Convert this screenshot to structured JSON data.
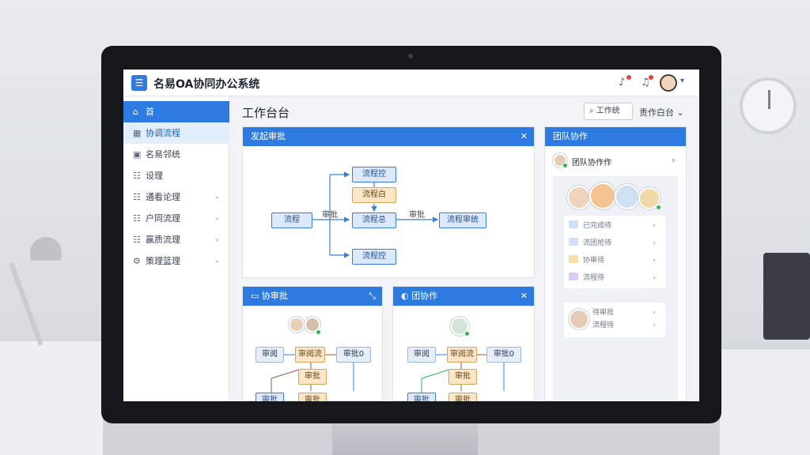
{
  "header": {
    "logo_glyph": "☰",
    "app_title": "名易OA协同办公系统",
    "icons": [
      "bell-icon",
      "notification-icon",
      "avatar"
    ]
  },
  "sidebar": {
    "items": [
      {
        "icon": "home-icon",
        "glyph": "⌂",
        "label": "首"
      },
      {
        "icon": "grid-icon",
        "glyph": "▦",
        "label": "协调流程"
      },
      {
        "icon": "box-icon",
        "glyph": "▣",
        "label": "名易邻统"
      },
      {
        "icon": "list-icon",
        "glyph": "☷",
        "label": "设理"
      },
      {
        "icon": "list-icon",
        "glyph": "☷",
        "label": "通看论理"
      },
      {
        "icon": "list-icon",
        "glyph": "☷",
        "label": "户同流理"
      },
      {
        "icon": "list-icon",
        "glyph": "☷",
        "label": "赢质流理"
      },
      {
        "icon": "gear-icon",
        "glyph": "⚙",
        "label": "策理篮理"
      }
    ]
  },
  "main": {
    "page_title": "工作台台",
    "search_label": "工作统",
    "workspace_label": "责作白台"
  },
  "panel_flow": {
    "title": "发起审批",
    "nodes": {
      "start": "流程",
      "top": "流程控",
      "mid_orange": "流程白",
      "center": "流程总",
      "bottom": "流程控",
      "end": "流程审统"
    },
    "edge_left": "审批",
    "edge_right": "审批"
  },
  "panel_small1": {
    "title": "协审批",
    "nodes": [
      "审阅",
      "审阅流",
      "审批0",
      "审批",
      "审批",
      "审批"
    ]
  },
  "panel_small2": {
    "title": "团协作",
    "nodes": [
      "审阅",
      "审阅流",
      "审批0",
      "审批",
      "审批",
      "审批"
    ]
  },
  "panel_team": {
    "title": "团队协作",
    "sub_label": "团队协作作",
    "rows": [
      "已完成待",
      "流团抢待",
      "协审待",
      "流程待"
    ],
    "bottom_rows": [
      "待审批",
      "流程待"
    ]
  },
  "colors": {
    "primary": "#2d7be0",
    "node_blue": "#dbe9fb",
    "node_orange": "#fbe7c8",
    "status_green": "#32b35a"
  }
}
